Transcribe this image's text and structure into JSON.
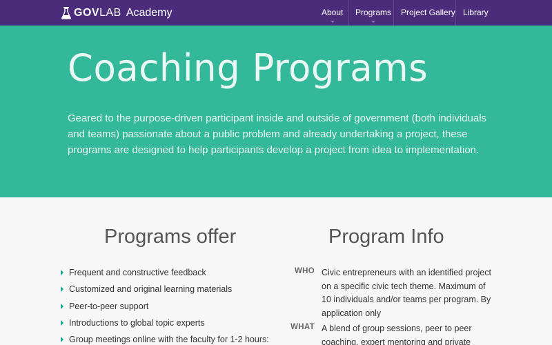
{
  "brand": {
    "gov": "GOV",
    "lab": "LAB",
    "academy": "Academy"
  },
  "nav": {
    "items": [
      "About",
      "Programs",
      "Project Gallery",
      "Library"
    ]
  },
  "hero": {
    "title": "Coaching Programs",
    "description": "Geared to the purpose-driven participant inside and outside of government (both individuals and teams) passionate about a public problem and already undertaking a project, these programs are designed to help participants develop a project from idea to implementation."
  },
  "programs_offer": {
    "title": "Programs offer",
    "items": [
      "Frequent and constructive feedback",
      "Customized and original learning materials",
      "Peer-to-peer support",
      "Introductions to global topic experts",
      "Group meetings online with the faculty for 1-2 hours:"
    ]
  },
  "program_info": {
    "title": "Program Info",
    "rows": [
      {
        "key": "WHO",
        "value": "Civic entrepreneurs with an identified project on a specific civic tech theme. Maximum of 10 individuals and/or teams per program. By application only"
      },
      {
        "key": "WHAT",
        "value": "A blend of group sessions, peer to peer coaching, expert mentoring and private"
      }
    ]
  },
  "colors": {
    "navbar": "#4b2c7a",
    "hero": "#34b89a",
    "bullet": "#1aa88c"
  }
}
